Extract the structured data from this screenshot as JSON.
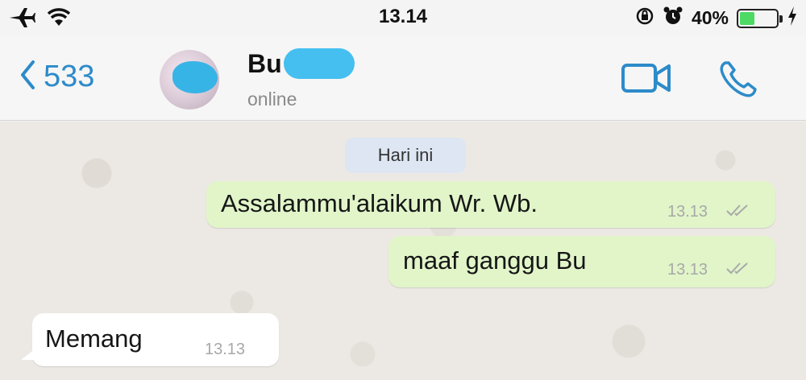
{
  "status_bar": {
    "time": "13.14",
    "battery_percent": "40%",
    "battery_level": 0.4,
    "icons": [
      "airplane-icon",
      "wifi-icon",
      "rotation-lock-icon",
      "alarm-icon",
      "battery-icon",
      "charging-icon"
    ]
  },
  "header": {
    "back_count": "533",
    "contact_name": "Bu",
    "contact_status": "online",
    "icons": [
      "back-chevron-icon",
      "video-camera-icon",
      "phone-icon"
    ],
    "accent_color": "#2d8bc9"
  },
  "chat": {
    "date_label": "Hari ini",
    "messages": [
      {
        "direction": "outgoing",
        "text": "Assalammu'alaikum Wr. Wb.",
        "time": "13.13",
        "read": true
      },
      {
        "direction": "outgoing",
        "text": "maaf ganggu Bu",
        "time": "13.13",
        "read": true
      },
      {
        "direction": "incoming",
        "text": "Memang",
        "time": "13.13"
      }
    ],
    "colors": {
      "outgoing_bubble": "#e1f5c9",
      "incoming_bubble": "#ffffff",
      "date_chip": "#dde6f2"
    }
  }
}
